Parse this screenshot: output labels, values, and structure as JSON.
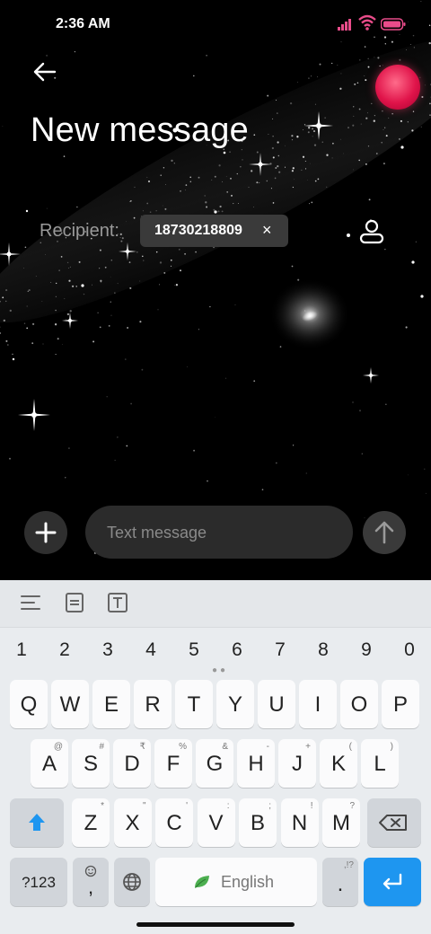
{
  "status_bar": {
    "time": "2:36 AM"
  },
  "header": {
    "back_icon": "arrow-left-icon",
    "title": "New message",
    "avatar_color": "#e0144a"
  },
  "recipient": {
    "label": "Recipient:",
    "chip_number": "18730218809",
    "chip_remove": "×",
    "contact_icon": "person-icon"
  },
  "composer": {
    "attach_icon": "plus-icon",
    "placeholder": "Text message",
    "send_icon": "arrow-up-icon"
  },
  "keyboard": {
    "toolbar_icons": [
      "menu-lines-icon",
      "document-icon",
      "text-box-icon"
    ],
    "number_row": [
      "1",
      "2",
      "3",
      "4",
      "5",
      "6",
      "7",
      "8",
      "9",
      "0"
    ],
    "row1": [
      {
        "key": "Q"
      },
      {
        "key": "W"
      },
      {
        "key": "E"
      },
      {
        "key": "R"
      },
      {
        "key": "T"
      },
      {
        "key": "Y"
      },
      {
        "key": "U"
      },
      {
        "key": "I"
      },
      {
        "key": "O"
      },
      {
        "key": "P"
      }
    ],
    "row2": [
      {
        "key": "A",
        "hint": "@"
      },
      {
        "key": "S",
        "hint": "#"
      },
      {
        "key": "D",
        "hint": "₹"
      },
      {
        "key": "F",
        "hint": "%"
      },
      {
        "key": "G",
        "hint": "&"
      },
      {
        "key": "H",
        "hint": "-"
      },
      {
        "key": "J",
        "hint": "+"
      },
      {
        "key": "K",
        "hint": "("
      },
      {
        "key": "L",
        "hint": ")"
      }
    ],
    "row3": [
      {
        "key": "Z",
        "hint": "*"
      },
      {
        "key": "X",
        "hint": "\""
      },
      {
        "key": "C",
        "hint": "'"
      },
      {
        "key": "V",
        "hint": ":"
      },
      {
        "key": "B",
        "hint": ";"
      },
      {
        "key": "N",
        "hint": "!"
      },
      {
        "key": "M",
        "hint": "?"
      }
    ],
    "shift_icon": "shift-arrow-icon",
    "backspace_icon": "backspace-icon",
    "symbols_label": "?123",
    "comma_label": ",",
    "emoji_icon": "emoji-icon",
    "globe_icon": "globe-icon",
    "space_label": "English",
    "space_icon": "leaf-icon",
    "period_label": ".",
    "period_hint": ",!?",
    "enter_icon": "enter-icon",
    "accent_color": "#1e96f0"
  }
}
